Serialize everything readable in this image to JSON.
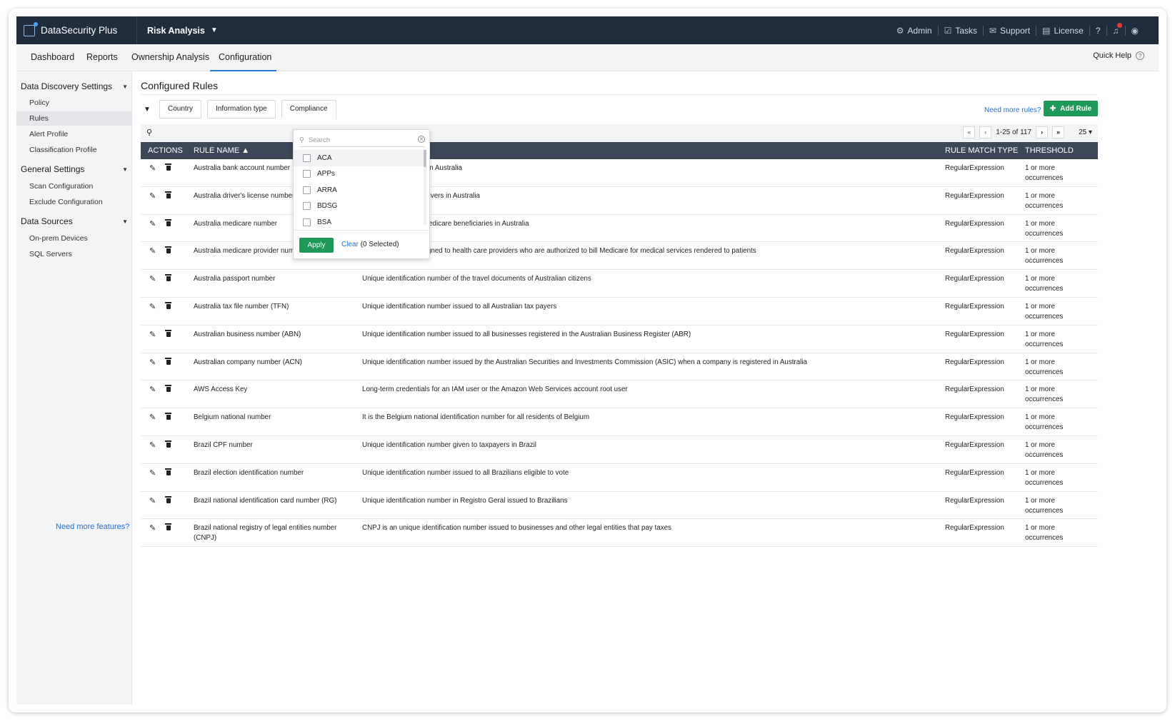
{
  "app": {
    "title": "DataSecurity Plus",
    "module": "Risk Analysis"
  },
  "topbar": {
    "admin": "Admin",
    "tasks": "Tasks",
    "support": "Support",
    "license": "License",
    "help": "?"
  },
  "tabs": [
    {
      "label": "Dashboard"
    },
    {
      "label": "Reports"
    },
    {
      "label": "Ownership Analysis"
    },
    {
      "label": "Configuration"
    }
  ],
  "quick_help": "Quick Help",
  "sidebar": {
    "sections": [
      {
        "title": "Data Discovery Settings",
        "items": [
          "Policy",
          "Rules",
          "Alert Profile",
          "Classification Profile"
        ]
      },
      {
        "title": "General Settings",
        "items": [
          "Scan Configuration",
          "Exclude Configuration"
        ]
      },
      {
        "title": "Data Sources",
        "items": [
          "On-prem Devices",
          "SQL Servers"
        ]
      }
    ],
    "active_item": "Rules",
    "more_link": "Need more features?"
  },
  "page": {
    "title": "Configured Rules",
    "filters": [
      "Country",
      "Information type",
      "Compliance"
    ],
    "need_more": "Need more rules?",
    "add_rule": "Add Rule",
    "pager": {
      "range": "1-25 of 117",
      "page_size": "25"
    }
  },
  "table": {
    "headers": {
      "actions": "ACTIONS",
      "name": "RULE NAME",
      "type": "RULE MATCH TYPE",
      "threshold": "THRESHOLD"
    },
    "rows": [
      {
        "name": "Australia bank account number",
        "desc": "sonal bank accounts in Australia",
        "type": "RegularExpression",
        "threshold": "1 or more occurrences"
      },
      {
        "name": "Australia driver's license number",
        "desc": "umber issued to all drivers in Australia",
        "type": "RegularExpression",
        "threshold": "1 or more occurrences"
      },
      {
        "name": "Australia medicare number",
        "desc": "umber issued to all medicare beneficiaries in Australia",
        "type": "RegularExpression",
        "threshold": "1 or more occurrences"
      },
      {
        "name": "Australia medicare provider number",
        "desc": "Unique identifier assigned to health care providers who are authorized to bill Medicare for medical services rendered to patients",
        "type": "RegularExpression",
        "threshold": "1 or more occurrences"
      },
      {
        "name": "Australia passport number",
        "desc": "Unique identification number of the travel documents of Australian citizens",
        "type": "RegularExpression",
        "threshold": "1 or more occurrences"
      },
      {
        "name": "Australia tax file number (TFN)",
        "desc": "Unique identification number issued to all Australian tax payers",
        "type": "RegularExpression",
        "threshold": "1 or more occurrences"
      },
      {
        "name": "Australian business number (ABN)",
        "desc": "Unique identification number issued to all businesses registered in the Australian Business Register (ABR)",
        "type": "RegularExpression",
        "threshold": "1 or more occurrences"
      },
      {
        "name": "Australian company number (ACN)",
        "desc": "Unique identification number issued by the Australian Securities and Investments Commission (ASIC) when a company is registered in Australia",
        "type": "RegularExpression",
        "threshold": "1 or more occurrences"
      },
      {
        "name": "AWS Access Key",
        "desc": "Long-term credentials for an IAM user or the Amazon Web Services account root user",
        "type": "RegularExpression",
        "threshold": "1 or more occurrences"
      },
      {
        "name": "Belgium national number",
        "desc": "It is the Belgium national identification number for all residents of Belgium",
        "type": "RegularExpression",
        "threshold": "1 or more occurrences"
      },
      {
        "name": "Brazil CPF number",
        "desc": "Unique identification number given to taxpayers in Brazil",
        "type": "RegularExpression",
        "threshold": "1 or more occurrences"
      },
      {
        "name": "Brazil election identification number",
        "desc": "Unique identification number issued to all Brazilians eligible to vote",
        "type": "RegularExpression",
        "threshold": "1 or more occurrences"
      },
      {
        "name": "Brazil national identification card number (RG)",
        "desc": "Unique identification number in Registro Geral issued to Brazilians",
        "type": "RegularExpression",
        "threshold": "1 or more occurrences"
      },
      {
        "name": "Brazil national registry of legal entities number (CNPJ)",
        "desc": "CNPJ is an unique identification number issued to businesses and other legal entities that pay taxes",
        "type": "RegularExpression",
        "threshold": "1 or more occurrences"
      }
    ]
  },
  "compliance_dropdown": {
    "search_placeholder": "Search",
    "options": [
      "ACA",
      "APPs",
      "ARRA",
      "BDSG",
      "BSA"
    ],
    "apply": "Apply",
    "clear": "Clear",
    "selected": "(0 Selected)"
  },
  "colors": {
    "topbar": "#1f2d3d",
    "accent": "#2d7bd5",
    "green": "#1e9957",
    "table_header": "#3c4858"
  }
}
